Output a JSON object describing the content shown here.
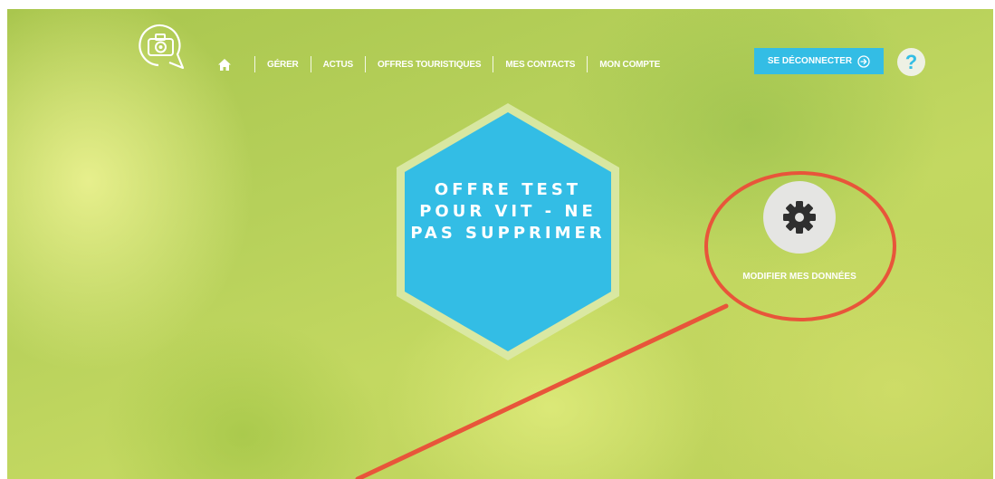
{
  "nav": {
    "home_icon": "home-icon",
    "items": [
      "GÉRER",
      "ACTUS",
      "OFFRES TOURISTIQUES",
      "MES CONTACTS",
      "MON COMPTE"
    ]
  },
  "header": {
    "logo_icon": "camera-chat-icon",
    "logout_label": "SE DÉCONNECTER",
    "logout_icon": "arrow-circle-right-icon",
    "help_label": "?"
  },
  "hero": {
    "title": "OFFRE TEST POUR VIT - NE PAS SUPPRIMER"
  },
  "settings": {
    "icon": "gear-icon",
    "label": "MODIFIER MES DONNÉES"
  },
  "colors": {
    "accent": "#33bde5",
    "annotation": "#e8553a"
  }
}
